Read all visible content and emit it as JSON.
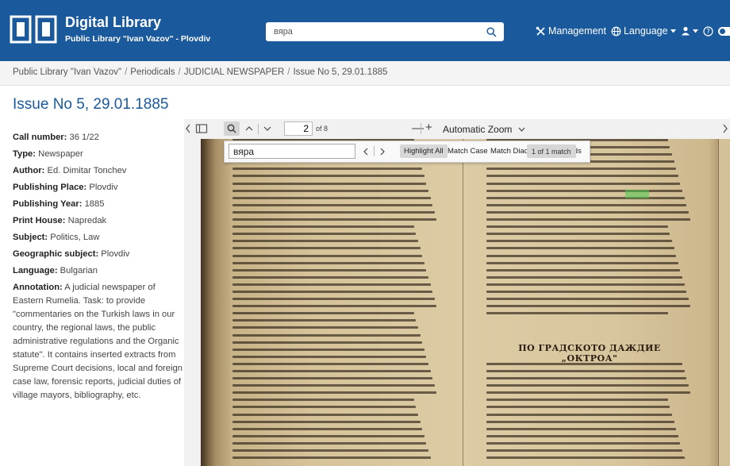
{
  "header": {
    "title": "Digital Library",
    "subtitle": "Public Library \"Ivan Vazov\" - Plovdiv",
    "search_value": "вяра",
    "nav": {
      "management": "Management",
      "language": "Language"
    },
    "colors": {
      "brand": "#1a5a9c"
    }
  },
  "breadcrumb": {
    "items": [
      "Public Library \"Ivan Vazov\"",
      "Periodicals",
      "JUDICIAL NEWSPAPER",
      "Issue No 5, 29.01.1885"
    ]
  },
  "page_title": "Issue No 5, 29.01.1885",
  "metadata": {
    "call_number": {
      "label": "Call number:",
      "value": "36 1/22"
    },
    "type": {
      "label": "Type:",
      "value": "Newspaper"
    },
    "author": {
      "label": "Author:",
      "value": "Ed. Dimitar Tonchev"
    },
    "publishing_place": {
      "label": "Publishing Place:",
      "value": "Plovdiv"
    },
    "publishing_year": {
      "label": "Publishing Year:",
      "value": "1885"
    },
    "print_house": {
      "label": "Print House:",
      "value": "Napredak"
    },
    "subject": {
      "label": "Subject:",
      "value": "Politics, Law"
    },
    "geographic_subject": {
      "label": "Geographic subject:",
      "value": "Plovdiv"
    },
    "language": {
      "label": "Language:",
      "value": "Bulgarian"
    },
    "annotation": {
      "label": "Annotation:",
      "value": "A judicial newspaper of Eastern Rumelia. Task: to provide \"commentaries on the Turkish laws in our country, the regional laws, the public administrative regulations and the Organic statute\". It contains inserted extracts from Supreme Court decisions, local and foreign case law, forensic reports, judicial duties of village mayors, bibliography, etc."
    }
  },
  "viewer": {
    "page_number": "2",
    "page_count": "of 8",
    "zoom": "Automatic Zoom",
    "find": {
      "query": "вяра",
      "highlight_all": "Highlight All",
      "match_case": "Match Case",
      "match_diacritics": "Match Diacritics",
      "whole_words": "Whole Words",
      "match_count": "1 of 1 match"
    },
    "page_headline": "ПО ГРАДСКОТО ДАЖДИЕ „ОКТРОА\""
  }
}
